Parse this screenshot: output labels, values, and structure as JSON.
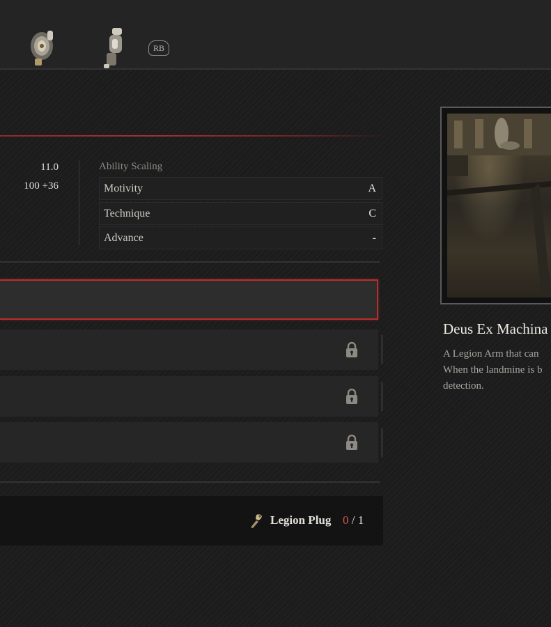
{
  "topbar": {
    "icons": [
      "arm-part-icon",
      "arm-attachment-icon"
    ],
    "rb_label": "RB"
  },
  "stats": {
    "value1": "11.0",
    "value2": "100 +36"
  },
  "ability_scaling": {
    "title": "Ability Scaling",
    "rows": [
      {
        "name": "Motivity",
        "grade": "A"
      },
      {
        "name": "Technique",
        "grade": "C"
      },
      {
        "name": "Advance",
        "grade": "-"
      }
    ]
  },
  "slots": [
    {
      "state": "selected"
    },
    {
      "state": "locked"
    },
    {
      "state": "locked"
    },
    {
      "state": "locked"
    }
  ],
  "material": {
    "name": "Legion Plug",
    "have": "0",
    "separator": "/",
    "need": "1"
  },
  "item": {
    "title": "Deus Ex Machina",
    "description_lines": [
      "A Legion Arm that can",
      "When the landmine is b",
      "detection."
    ]
  },
  "colors": {
    "accent_red": "#b8302d",
    "have_count": "#d05a4a"
  }
}
